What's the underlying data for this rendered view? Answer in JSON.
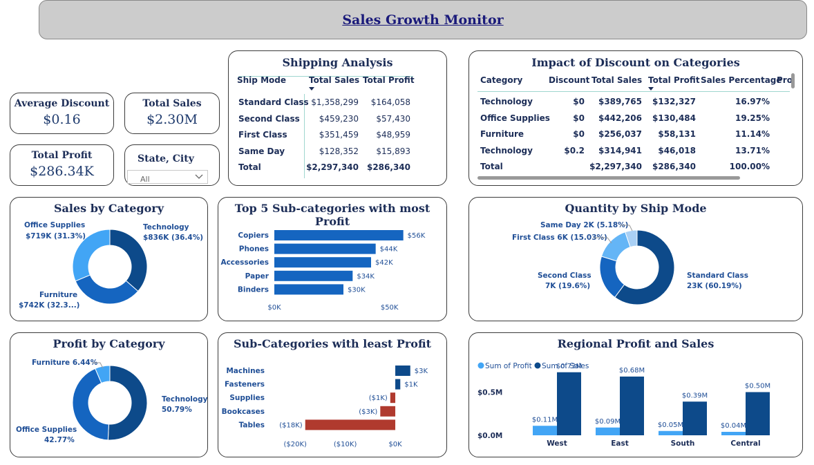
{
  "header": {
    "title": "Sales Growth Monitor"
  },
  "kpis": {
    "avg_discount": {
      "label": "Average Discount",
      "value": "$0.16"
    },
    "total_sales": {
      "label": "Total Sales",
      "value": "$2.30M"
    },
    "total_profit": {
      "label": "Total Profit",
      "value": "$286.34K"
    }
  },
  "slicer": {
    "label": "State, City",
    "value": "All"
  },
  "shipping": {
    "title": "Shipping Analysis",
    "headers": [
      "Ship Mode",
      "Total Sales",
      "Total Profit"
    ],
    "rows": [
      [
        "Standard Class",
        "$1,358,299",
        "$164,058"
      ],
      [
        "Second Class",
        "$459,230",
        "$57,430"
      ],
      [
        "First Class",
        "$351,459",
        "$48,959"
      ],
      [
        "Same Day",
        "$128,352",
        "$15,893"
      ]
    ],
    "total": [
      "Total",
      "$2,297,340",
      "$286,340"
    ]
  },
  "discount_impact": {
    "title": "Impact of Discount on Categories",
    "headers": [
      "Category",
      "Discount",
      "Total Sales",
      "Total Profit",
      "Sales Percentage",
      "Pro"
    ],
    "rows": [
      [
        "Technology",
        "$0",
        "$389,765",
        "$132,327",
        "16.97%"
      ],
      [
        "Office Supplies",
        "$0",
        "$442,206",
        "$130,484",
        "19.25%"
      ],
      [
        "Furniture",
        "$0",
        "$256,037",
        "$58,131",
        "11.14%"
      ],
      [
        "Technology",
        "$0.2",
        "$314,941",
        "$46,018",
        "13.71%"
      ]
    ],
    "total": [
      "Total",
      "",
      "$2,297,340",
      "$286,340",
      "100.00%"
    ]
  },
  "sales_by_category": {
    "title": "Sales by Category",
    "labels": {
      "office_name": "Office Supplies",
      "office_value": "$719K (31.3%)",
      "tech_name": "Technology",
      "tech_value": "$836K (36.4%)",
      "furn_name": "Furniture",
      "furn_value": "$742K (32.3...)"
    }
  },
  "top5": {
    "title": "Top 5 Sub-categories with most Profit"
  },
  "quantity_ship": {
    "title": "Quantity by Ship Mode",
    "labels": {
      "same_day": "Same Day 2K (5.18%)",
      "first_class": "First Class 6K (15.03%)",
      "second_name": "Second Class",
      "second_value": "7K (19.6%)",
      "standard_name": "Standard Class",
      "standard_value": "23K (60.19%)"
    }
  },
  "profit_by_category": {
    "title": "Profit by Category",
    "labels": {
      "furniture": "Furniture 6.44%",
      "tech_name": "Technology",
      "tech_value": "50.79%",
      "office_name": "Office Supplies",
      "office_value": "42.77%"
    }
  },
  "least_profit": {
    "title": "Sub-Categories with least Profit"
  },
  "regional": {
    "title": "Regional Profit and Sales"
  },
  "colors": {
    "dark_blue": "#0d4a8a",
    "mid_blue": "#1565c0",
    "light_blue": "#42a5f5",
    "red": "#b03a2e"
  },
  "chart_data": [
    {
      "type": "pie",
      "title": "Sales by Category",
      "categories": [
        "Technology",
        "Furniture",
        "Office Supplies"
      ],
      "values": [
        836,
        742,
        719
      ],
      "unit": "$K",
      "colors": [
        "#0d4a8a",
        "#1565c0",
        "#42a5f5"
      ]
    },
    {
      "type": "bar",
      "title": "Top 5 Sub-categories with most Profit",
      "orientation": "horizontal",
      "categories": [
        "Copiers",
        "Phones",
        "Accessories",
        "Paper",
        "Binders"
      ],
      "values": [
        56,
        44,
        42,
        34,
        30
      ],
      "data_labels": [
        "$56K",
        "$44K",
        "$42K",
        "$34K",
        "$30K"
      ],
      "xlim": [
        0,
        60
      ],
      "xticks": [
        0,
        50
      ],
      "xtick_labels": [
        "$0K",
        "$50K"
      ],
      "color": "#1565c0"
    },
    {
      "type": "pie",
      "title": "Quantity by Ship Mode",
      "categories": [
        "Standard Class",
        "Second Class",
        "First Class",
        "Same Day"
      ],
      "values": [
        60.19,
        19.6,
        15.03,
        5.18
      ],
      "unit": "%",
      "colors": [
        "#0d4a8a",
        "#1565c0",
        "#64b5f6",
        "#a9d0f5"
      ]
    },
    {
      "type": "pie",
      "title": "Profit by Category",
      "categories": [
        "Technology",
        "Office Supplies",
        "Furniture"
      ],
      "values": [
        50.79,
        42.77,
        6.44
      ],
      "unit": "%",
      "colors": [
        "#0d4a8a",
        "#1565c0",
        "#42a5f5"
      ]
    },
    {
      "type": "bar",
      "title": "Sub-Categories with least Profit",
      "orientation": "horizontal",
      "categories": [
        "Machines",
        "Fasteners",
        "Supplies",
        "Bookcases",
        "Tables"
      ],
      "values": [
        3,
        1,
        -1,
        -3,
        -18
      ],
      "data_labels": [
        "$3K",
        "$1K",
        "($1K)",
        "($3K)",
        "($18K)"
      ],
      "xlim": [
        -21,
        4
      ],
      "xticks": [
        -20,
        -10,
        0
      ],
      "xtick_labels": [
        "($20K)",
        "($10K)",
        "$0K"
      ],
      "positive_color": "#0d4a8a",
      "negative_color": "#b03a2e"
    },
    {
      "type": "bar",
      "title": "Regional Profit and Sales",
      "categories": [
        "West",
        "East",
        "South",
        "Central"
      ],
      "series": [
        {
          "name": "Sum of Profit",
          "values": [
            0.11,
            0.09,
            0.05,
            0.04
          ],
          "labels": [
            "$0.11M",
            "$0.09M",
            "$0.05M",
            "$0.04M"
          ],
          "color": "#42a5f5"
        },
        {
          "name": "Sum of Sales",
          "values": [
            0.73,
            0.68,
            0.39,
            0.5
          ],
          "labels": [
            "$0.73M",
            "$0.68M",
            "$0.39M",
            "$0.50M"
          ],
          "color": "#0d4a8a"
        }
      ],
      "ylim": [
        0,
        0.8
      ],
      "yticks": [
        0,
        0.5
      ],
      "ytick_labels": [
        "$0.0M",
        "$0.5M"
      ],
      "legend": "top-left"
    }
  ]
}
